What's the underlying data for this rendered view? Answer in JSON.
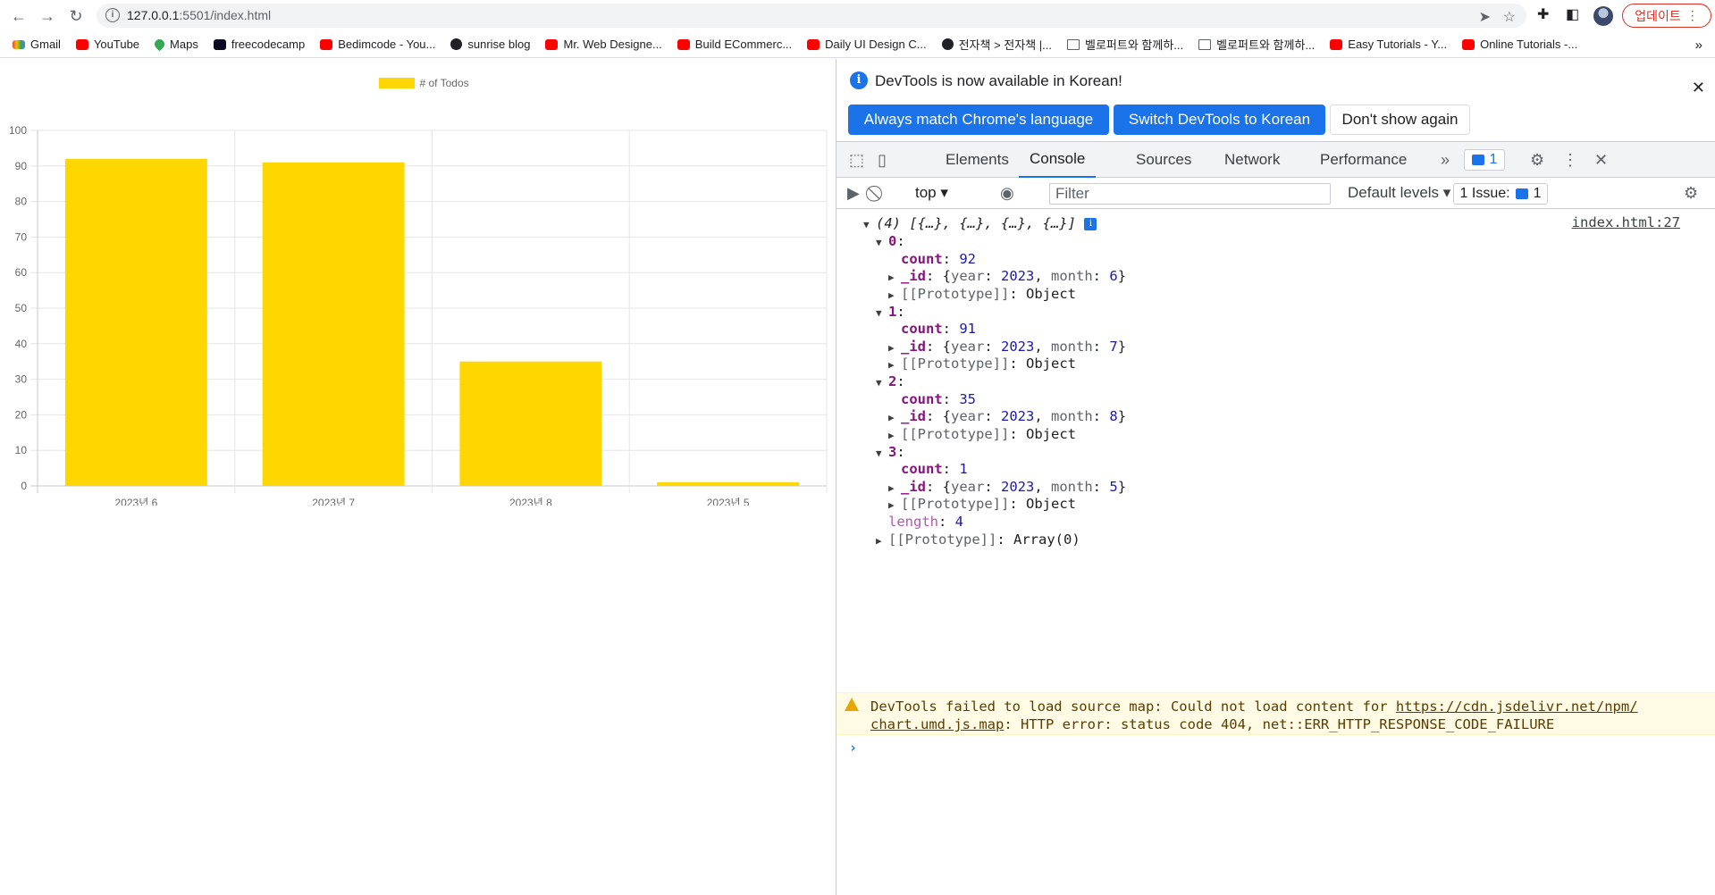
{
  "browser": {
    "url_host": "127.0.0.1",
    "url_rest": ":5501/index.html",
    "update_label": "업데이트",
    "bookmarks": [
      {
        "label": "Gmail",
        "icon": "gmail-icon"
      },
      {
        "label": "YouTube",
        "icon": "youtube-icon"
      },
      {
        "label": "Maps",
        "icon": "maps-icon"
      },
      {
        "label": "freecodecamp",
        "icon": "freecodecamp-icon"
      },
      {
        "label": "Bedimcode - You...",
        "icon": "youtube-icon"
      },
      {
        "label": "sunrise blog",
        "icon": "globe-icon"
      },
      {
        "label": "Mr. Web Designe...",
        "icon": "youtube-icon"
      },
      {
        "label": "Build ECommerc...",
        "icon": "youtube-icon"
      },
      {
        "label": "Daily UI Design C...",
        "icon": "youtube-icon"
      },
      {
        "label": "전자책 > 전자책 |...",
        "icon": "globe-icon"
      },
      {
        "label": "벨로퍼트와 함께하...",
        "icon": "book-icon"
      },
      {
        "label": "벨로퍼트와 함께하...",
        "icon": "book-icon"
      },
      {
        "label": "Easy Tutorials - Y...",
        "icon": "youtube-icon"
      },
      {
        "label": "Online Tutorials -...",
        "icon": "youtube-icon"
      }
    ],
    "bookmarks_more": "»"
  },
  "chart_data": {
    "type": "bar",
    "categories": [
      "2023년 6",
      "2023년 7",
      "2023년 8",
      "2023년 5"
    ],
    "series": [
      {
        "name": "# of Todos",
        "values": [
          92,
          91,
          35,
          1
        ],
        "color": "#ffd700"
      }
    ],
    "ylim": [
      0,
      100
    ],
    "yticks": [
      0,
      10,
      20,
      30,
      40,
      50,
      60,
      70,
      80,
      90,
      100
    ],
    "legend_position": "top",
    "grid": true
  },
  "devtools": {
    "notice": {
      "message": "DevTools is now available in Korean!",
      "btn_match": "Always match Chrome's language",
      "btn_switch": "Switch DevTools to Korean",
      "btn_dismiss": "Don't show again"
    },
    "tabs": [
      "Elements",
      "Console",
      "Sources",
      "Network",
      "Performance"
    ],
    "active_tab": "Console",
    "issues_count": "1",
    "console_bar": {
      "context": "top",
      "filter_placeholder": "Filter",
      "levels": "Default levels",
      "issues_label": "1 Issue:",
      "issues_count": "1"
    },
    "log": {
      "summary": "(4) [{…}, {…}, {…}, {…}]",
      "source": "index.html:27",
      "items": [
        {
          "index": "0",
          "count": "92",
          "year": "2023",
          "month": "6"
        },
        {
          "index": "1",
          "count": "91",
          "year": "2023",
          "month": "7"
        },
        {
          "index": "2",
          "count": "35",
          "year": "2023",
          "month": "8"
        },
        {
          "index": "3",
          "count": "1",
          "year": "2023",
          "month": "5"
        }
      ],
      "prototype_object": "Object",
      "length": "4",
      "array_prototype": "Array(0)"
    },
    "warning": {
      "prefix": "DevTools failed to load source map: Could not load content for ",
      "link1": "https://cdn.jsdelivr.net/npm/",
      "link2": "chart.umd.js.map",
      "suffix": ": HTTP error: status code 404, net::ERR_HTTP_RESPONSE_CODE_FAILURE"
    }
  }
}
